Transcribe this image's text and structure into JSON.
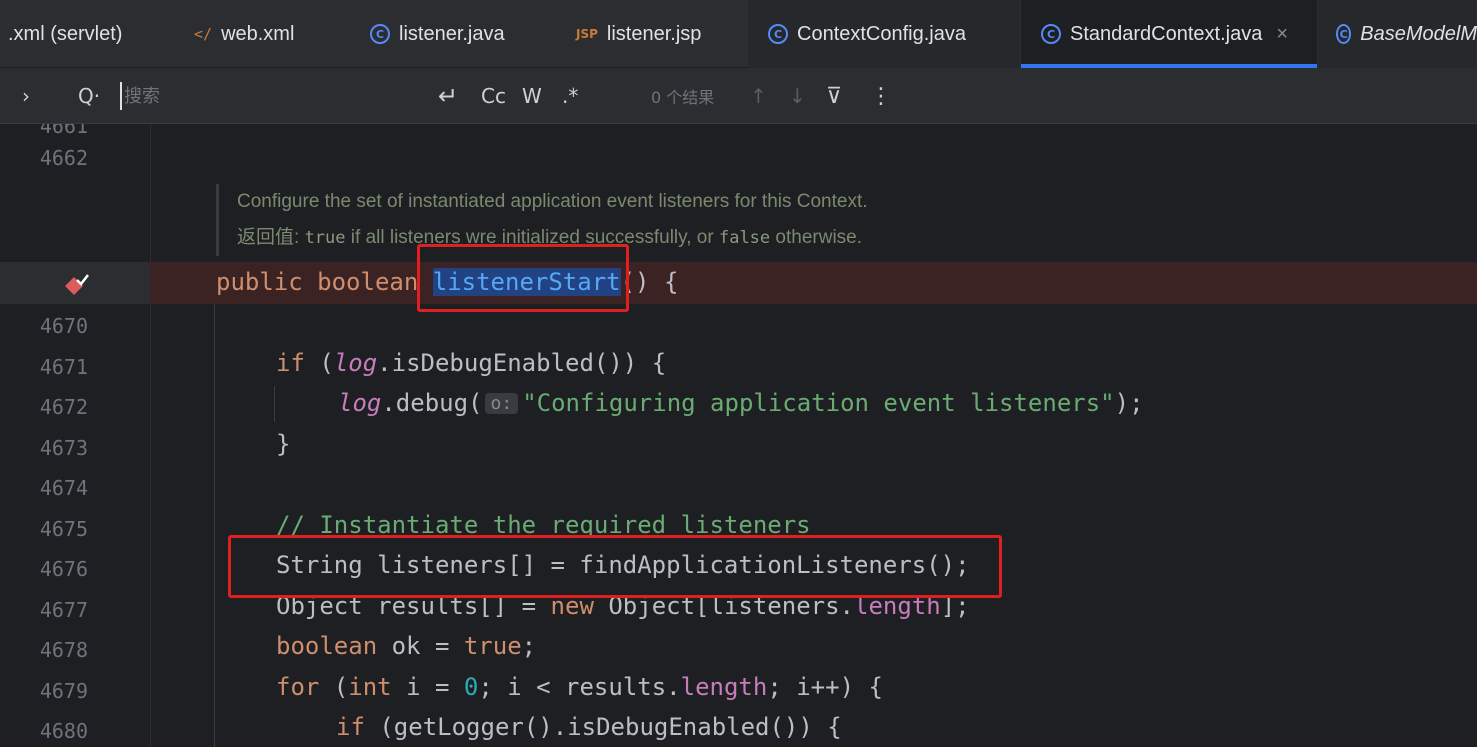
{
  "tabs": [
    {
      "label": ".xml (servlet)",
      "icon": "xml-file-icon"
    },
    {
      "label": "web.xml",
      "icon": "xml-file-icon"
    },
    {
      "label": "listener.java",
      "icon": "java-class-icon"
    },
    {
      "label": "listener.jsp",
      "icon": "jsp-file-icon"
    },
    {
      "label": "ContextConfig.java",
      "icon": "java-class-icon"
    },
    {
      "label": "StandardContext.java",
      "icon": "java-class-icon",
      "active": true,
      "close": "×"
    },
    {
      "label": "BaseModelM",
      "icon": "java-class-icon"
    }
  ],
  "search": {
    "expand_glyph": "›",
    "search_glyph": "Q·",
    "placeholder": "搜索",
    "value": "",
    "newline_glyph": "↵",
    "match_case": "Cc",
    "words": "W",
    "regex": ".*",
    "results": "0 个结果",
    "prev_glyph": "↑",
    "next_glyph": "↓",
    "filter_glyph": "⊽",
    "more_glyph": "⋮"
  },
  "editor": {
    "line_numbers": {
      "l0": "4661",
      "l1": "4662",
      "l2": "4670",
      "l3": "4671",
      "l4": "4672",
      "l5": "4673",
      "l6": "4674",
      "l7": "4675",
      "l8": "4676",
      "l9": "4677",
      "l10": "4678",
      "l11": "4679",
      "l12": "4680"
    },
    "doc": {
      "line1": "Configure the set of instantiated application event listeners for this Context.",
      "returns_label": "返回值:",
      "true_kw": "true",
      "middle": " if all listeners wre initialized successfully, or ",
      "false_kw": "false",
      "end": " otherwise."
    },
    "method_sig": {
      "mods": "public boolean ",
      "name": "listenerStart",
      "rest": "() {"
    },
    "if_line": {
      "kw": "if",
      "pre": " (",
      "log": "log",
      "rest": ".isDebugEnabled()) {"
    },
    "debug_line": {
      "log": "log",
      "call": ".debug(",
      "hint": "o:",
      "str": "\"Configuring application event listeners\"",
      "end": ");"
    },
    "close_brace": "}",
    "comment": "// Instantiate the required listeners",
    "listeners_line": "String listeners[] = findApplicationListeners();",
    "results_line": {
      "pre": "Object results[] = ",
      "kw": "new",
      "mid": " Object[listeners.",
      "fld": "length",
      "end": "];"
    },
    "ok_line": {
      "kw": "boolean",
      "mid": " ok = ",
      "val": "true",
      "end": ";"
    },
    "for_line": {
      "kw": "for",
      "p1": " (",
      "kw2": "int",
      "p2": " i = ",
      "num": "0",
      "p3": "; i < results.",
      "fld": "length",
      "p4": "; i++) {"
    },
    "if2_line": {
      "kw": "if",
      "rest": " (getLogger().isDebugEnabled()) {"
    }
  }
}
